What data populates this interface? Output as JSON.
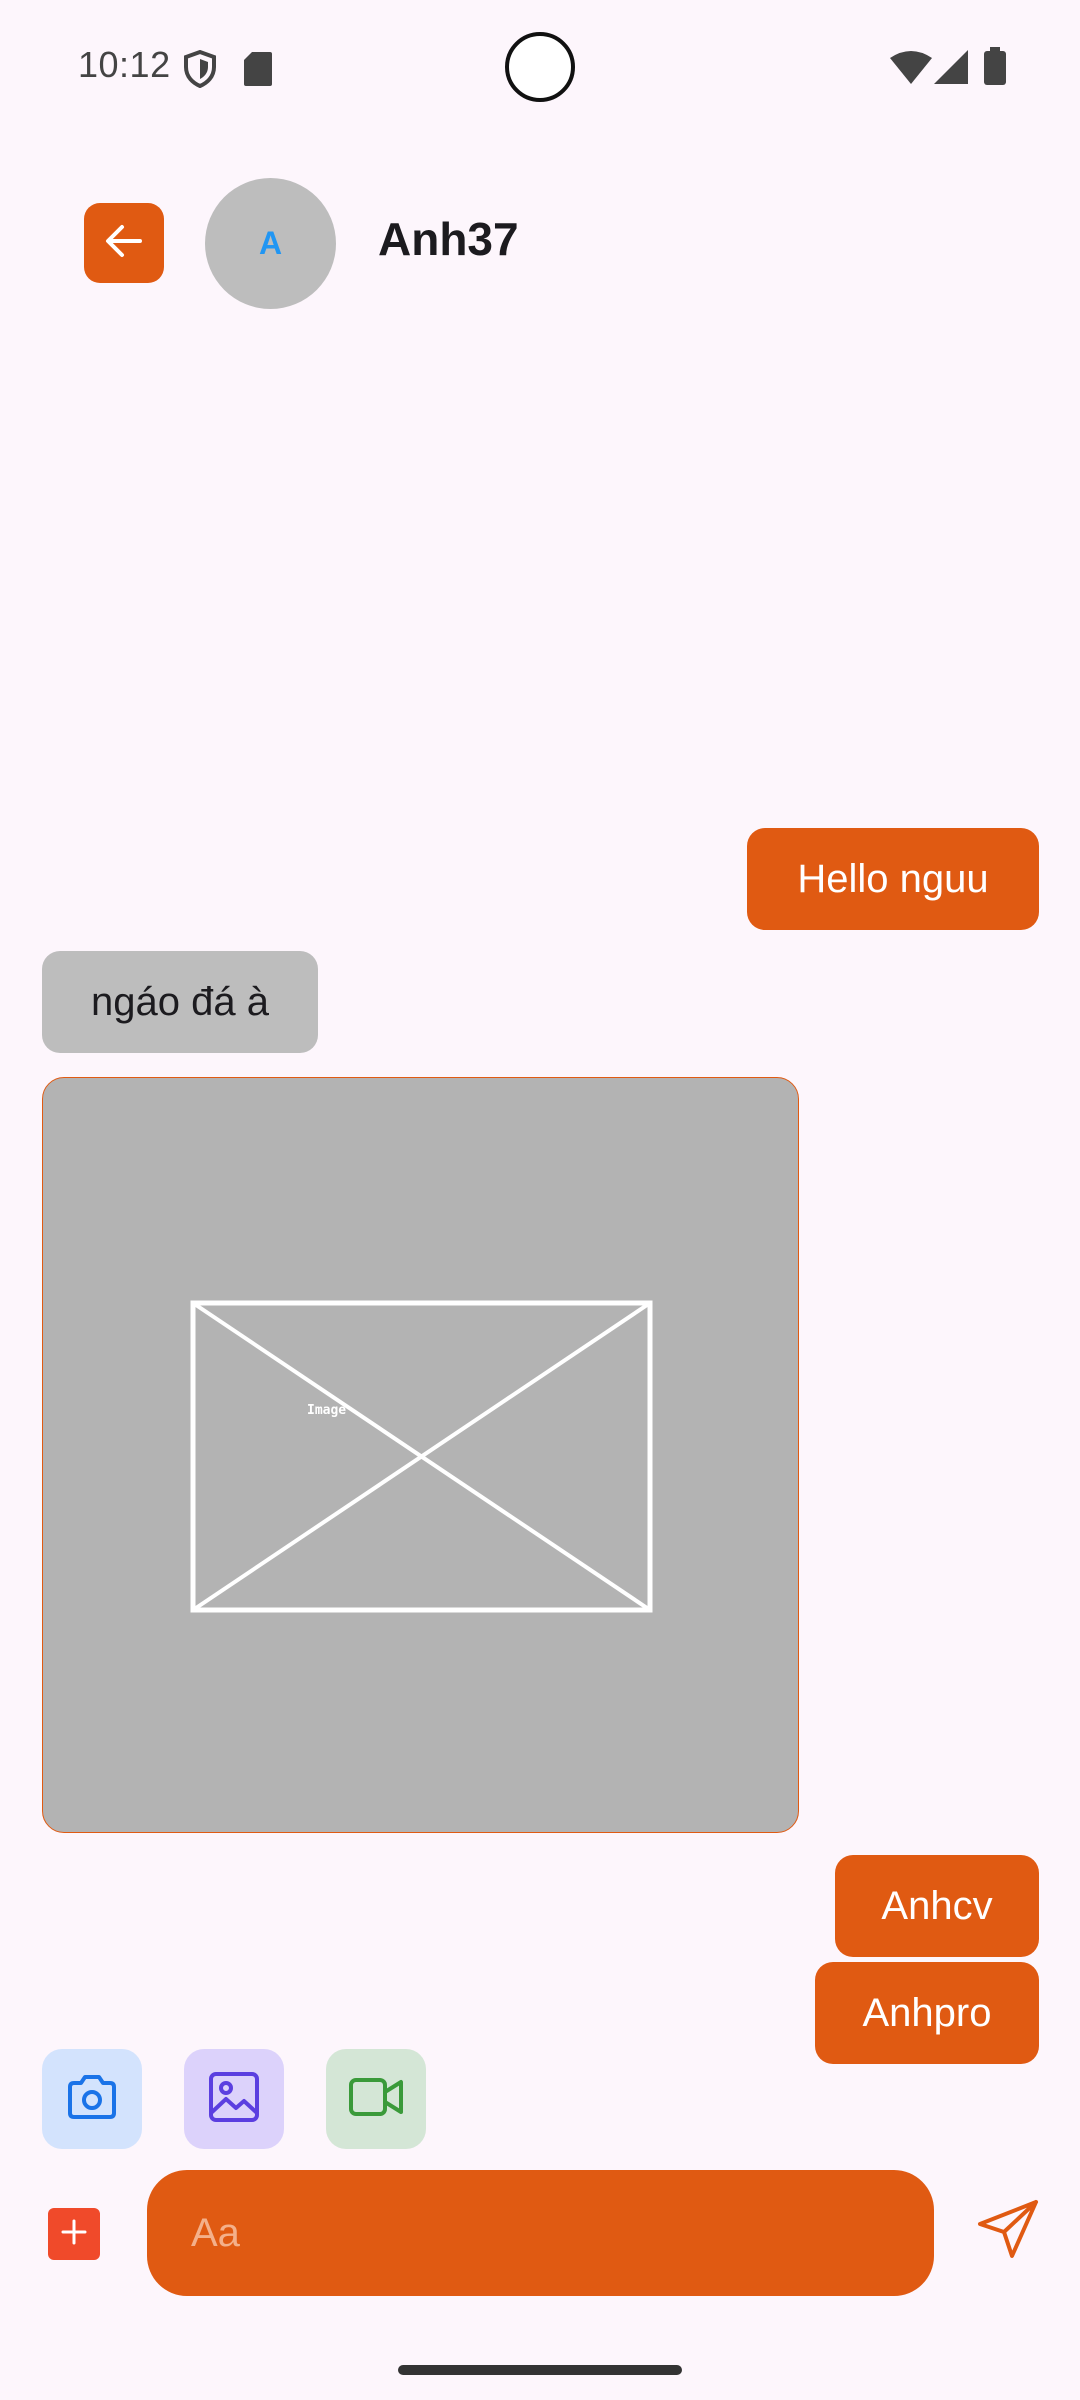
{
  "status_bar": {
    "time": "10:12",
    "icons": [
      "shield-icon",
      "sd-card-icon",
      "wifi-icon",
      "signal-icon",
      "battery-icon"
    ]
  },
  "header": {
    "back_icon": "arrow-left-icon",
    "avatar_initial": "A",
    "contact_name": "Anh37"
  },
  "messages": [
    {
      "type": "text",
      "direction": "sent",
      "text": "Hello nguu"
    },
    {
      "type": "text",
      "direction": "received",
      "text": "ngáo đá à"
    },
    {
      "type": "image",
      "direction": "received",
      "placeholder_label": "Image"
    },
    {
      "type": "text",
      "direction": "sent",
      "text": "Anhcv"
    },
    {
      "type": "text",
      "direction": "sent",
      "text": "Anhpro"
    }
  ],
  "attachments": [
    {
      "icon": "camera-icon",
      "color": "#1a73e8",
      "bg": "#d3e3fd"
    },
    {
      "icon": "image-icon",
      "color": "#5b3fe0",
      "bg": "#dcd2fb"
    },
    {
      "icon": "video-icon",
      "color": "#3a9a3a",
      "bg": "#d4e6d6"
    }
  ],
  "composer": {
    "placeholder": "Aa",
    "plus_icon": "plus-icon",
    "send_icon": "send-icon"
  },
  "colors": {
    "accent": "#e05a12",
    "background": "#fdf6fc",
    "received_bubble": "#bdbdbd",
    "plus_button": "#f04a2a"
  }
}
